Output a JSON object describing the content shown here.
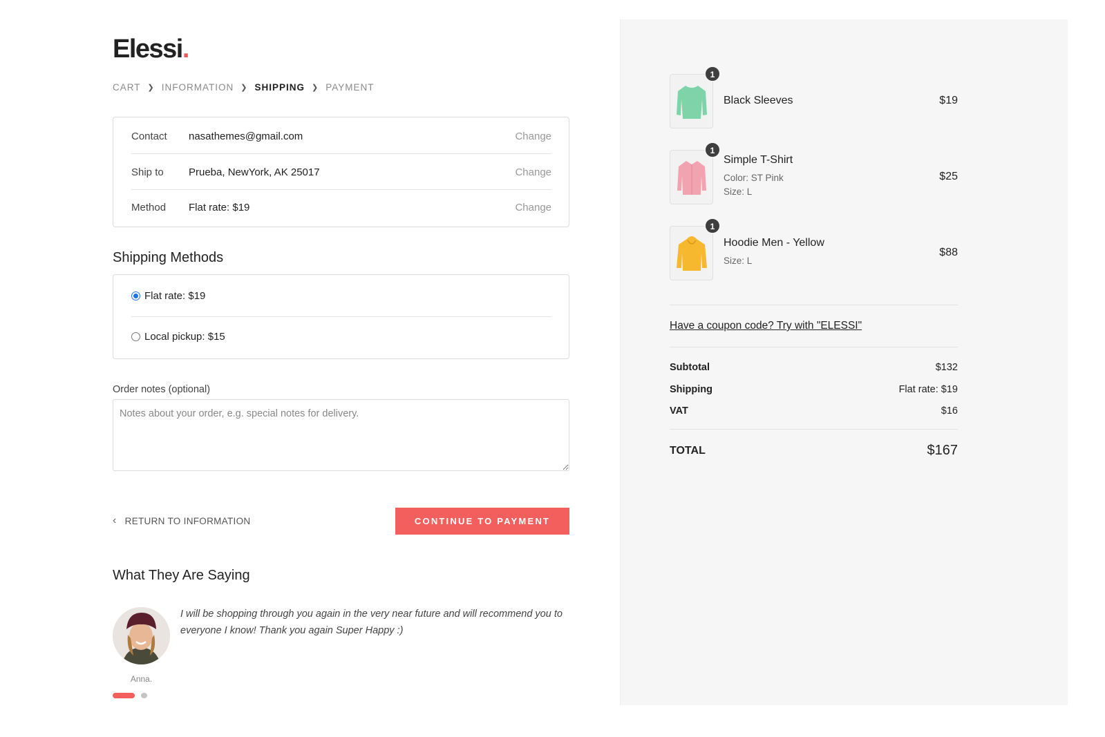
{
  "brand": {
    "name": "Elessi",
    "dot": ".",
    "accent_color": "#f25757"
  },
  "breadcrumb": [
    {
      "label": "CART",
      "active": false
    },
    {
      "label": "INFORMATION",
      "active": false
    },
    {
      "label": "SHIPPING",
      "active": true
    },
    {
      "label": "PAYMENT",
      "active": false
    }
  ],
  "review": {
    "contact": {
      "label": "Contact",
      "value": "nasathemes@gmail.com",
      "action": "Change"
    },
    "ship_to": {
      "label": "Ship to",
      "value": "Prueba, NewYork, AK 25017",
      "action": "Change"
    },
    "method": {
      "label": "Method",
      "value": "Flat rate: $19",
      "action": "Change"
    }
  },
  "shipping_methods": {
    "title": "Shipping Methods",
    "options": [
      {
        "label": "Flat rate: $19",
        "selected": true
      },
      {
        "label": "Local pickup: $15",
        "selected": false
      }
    ]
  },
  "order_notes": {
    "label": "Order notes (optional)",
    "placeholder": "Notes about your order, e.g. special notes for delivery.",
    "value": ""
  },
  "actions": {
    "return_label": "RETURN TO INFORMATION",
    "continue_label": "CONTINUE TO PAYMENT",
    "button_color": "#f25f5c"
  },
  "testimonials": {
    "title": "What They Are Saying",
    "quote": "I will be shopping through you again in the very near future and will recommend you to everyone I know! Thank you again Super Happy :)",
    "author": "Anna.",
    "active_index": 0,
    "count": 2
  },
  "cart": {
    "items": [
      {
        "qty": "1",
        "name": "Black Sleeves",
        "meta": [],
        "price": "$19",
        "icon": "green-sweater-icon"
      },
      {
        "qty": "1",
        "name": "Simple T-Shirt",
        "meta": [
          "Color: ST Pink",
          "Size: L"
        ],
        "price": "$25",
        "icon": "pink-shirt-icon"
      },
      {
        "qty": "1",
        "name": "Hoodie Men - Yellow",
        "meta": [
          "Size: L"
        ],
        "price": "$88",
        "icon": "yellow-hoodie-icon"
      }
    ],
    "coupon_text": "Have a coupon code? Try with \"ELESSI\"",
    "summary": {
      "subtotal": {
        "label": "Subtotal",
        "value": "$132"
      },
      "shipping": {
        "label": "Shipping",
        "value": "Flat rate: $19"
      },
      "vat": {
        "label": "VAT",
        "value": "$16"
      },
      "total": {
        "label": "TOTAL",
        "value": "$167"
      }
    }
  }
}
